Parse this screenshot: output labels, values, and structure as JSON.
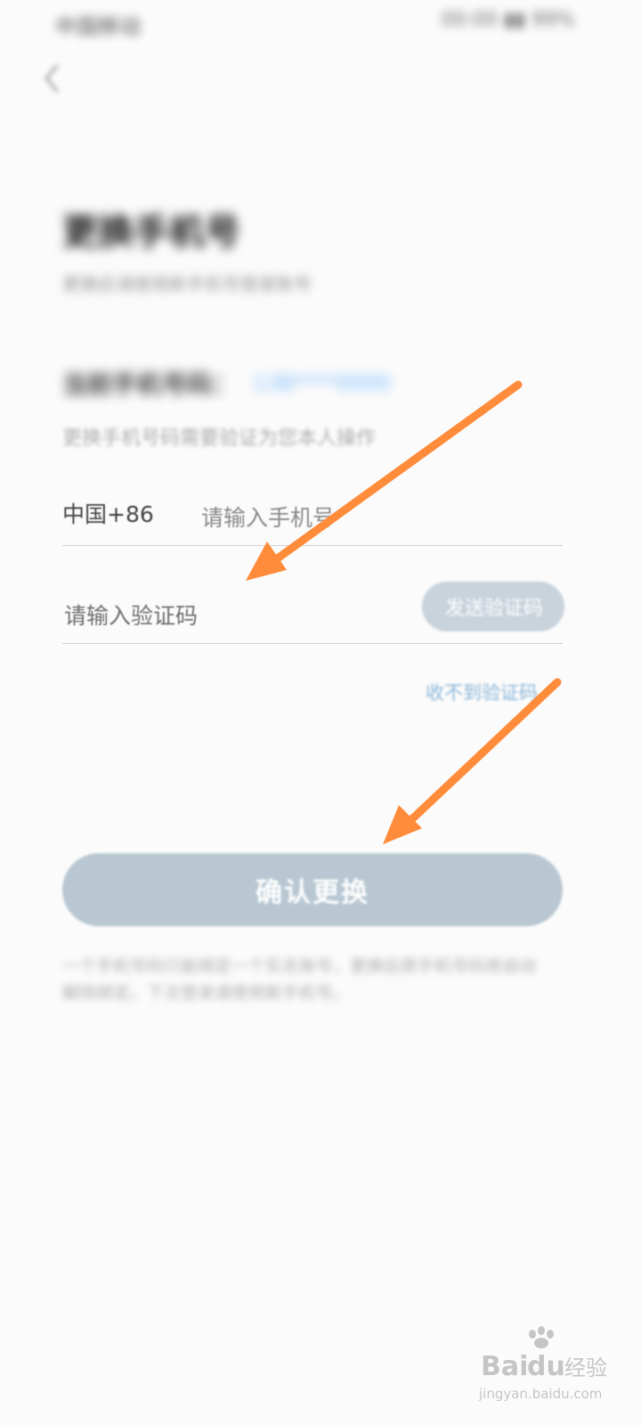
{
  "status_bar": {
    "left_text": "中国移动",
    "right_text": "00:00 ▮▮ 99%"
  },
  "header": {
    "back_icon": "chevron-left-icon",
    "title": "更换手机号",
    "subtitle": "更换后请使用新手机号登录账号"
  },
  "current_phone": {
    "label": "当前手机号码：",
    "value": "138****0000",
    "hint": "更换手机号码需要验证为您本人操作"
  },
  "form": {
    "country_code": "中国+86",
    "phone_placeholder": "请输入手机号",
    "code_placeholder": "请输入验证码",
    "send_code_label": "发送验证码",
    "no_code_link": "收不到验证码"
  },
  "confirm_button_label": "确认更换",
  "footnote": "一个手机号码只能绑定一个实名账号，更换后原手机号码将自动解除绑定。下次登录请使用新手机号。",
  "annotation": {
    "arrow_color": "#ff8c3a"
  },
  "watermark": {
    "brand": "Baidu经验",
    "url": "jingyan.baidu.com"
  },
  "colors": {
    "button_disabled": "#b8c7d2",
    "link": "#8ab6da",
    "accent": "#1a8cff"
  }
}
